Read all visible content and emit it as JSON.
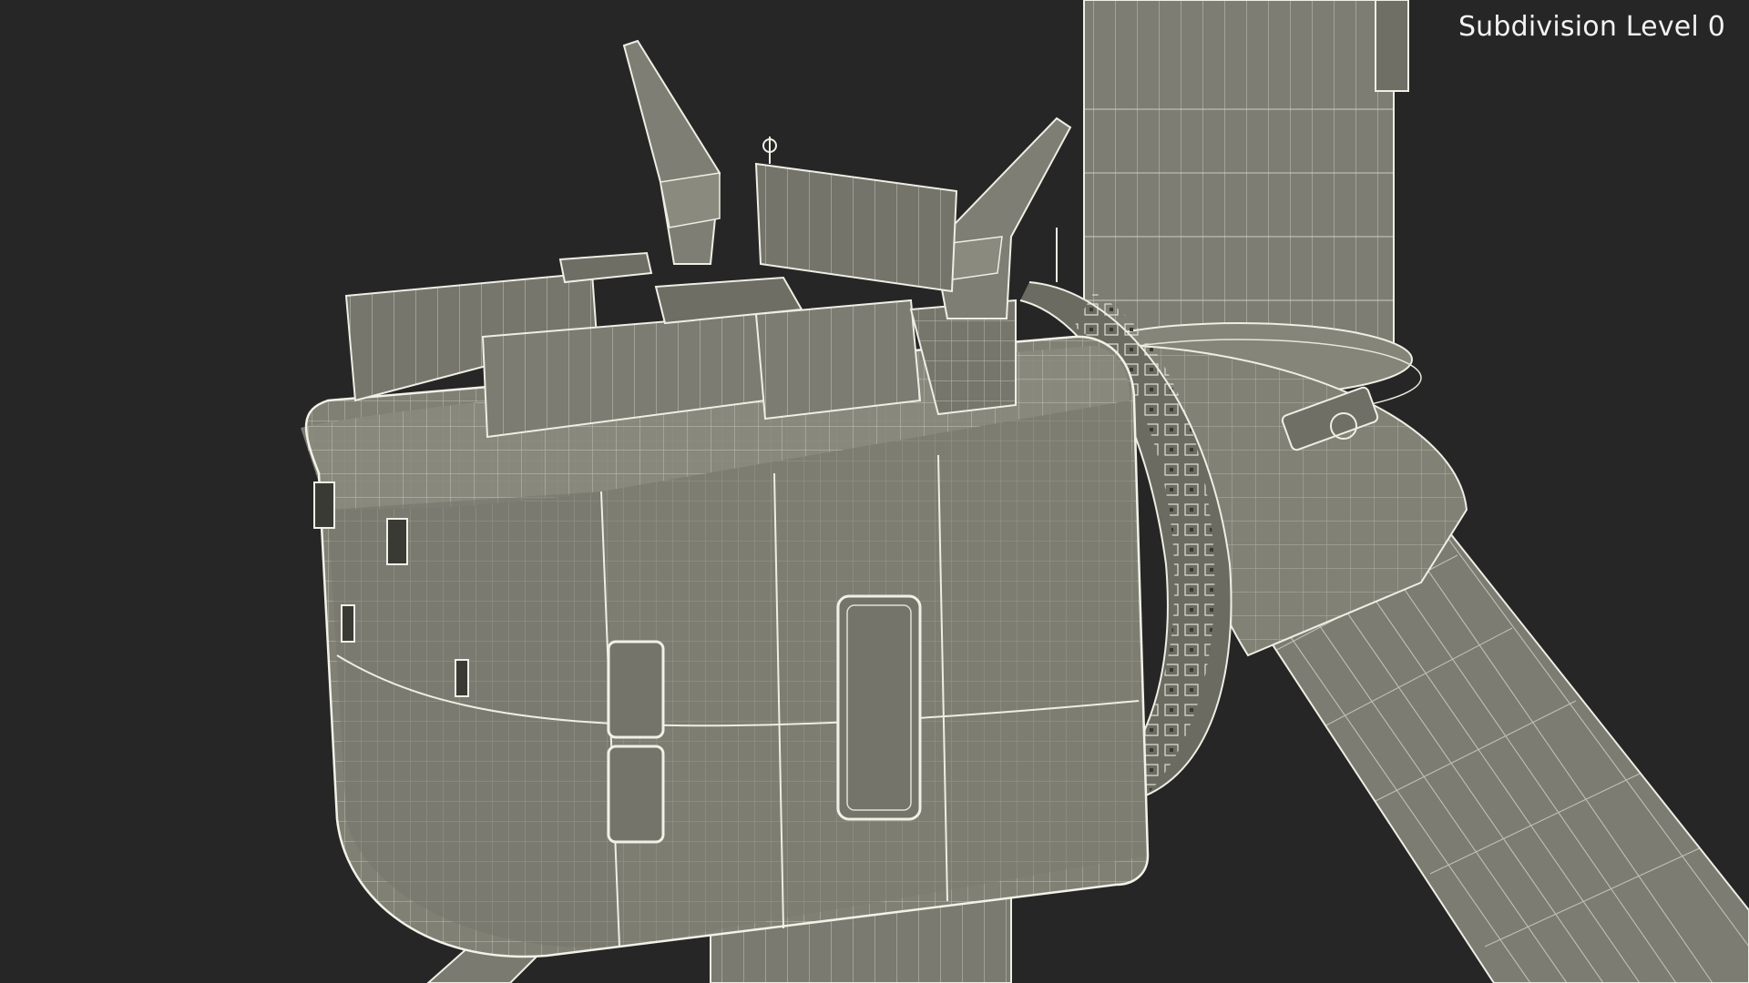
{
  "viewport": {
    "subdivision_label": "Subdivision Level 0",
    "colors": {
      "background": "#262626",
      "surface": "#7f7f74",
      "surface_dark": "#6e6e64",
      "surface_light": "#8c8c80",
      "wire": "#d8d8cc",
      "edge": "#f0f0e6",
      "label": "#f2f2f2"
    },
    "subject": "wind-turbine-nacelle-wireframe"
  }
}
